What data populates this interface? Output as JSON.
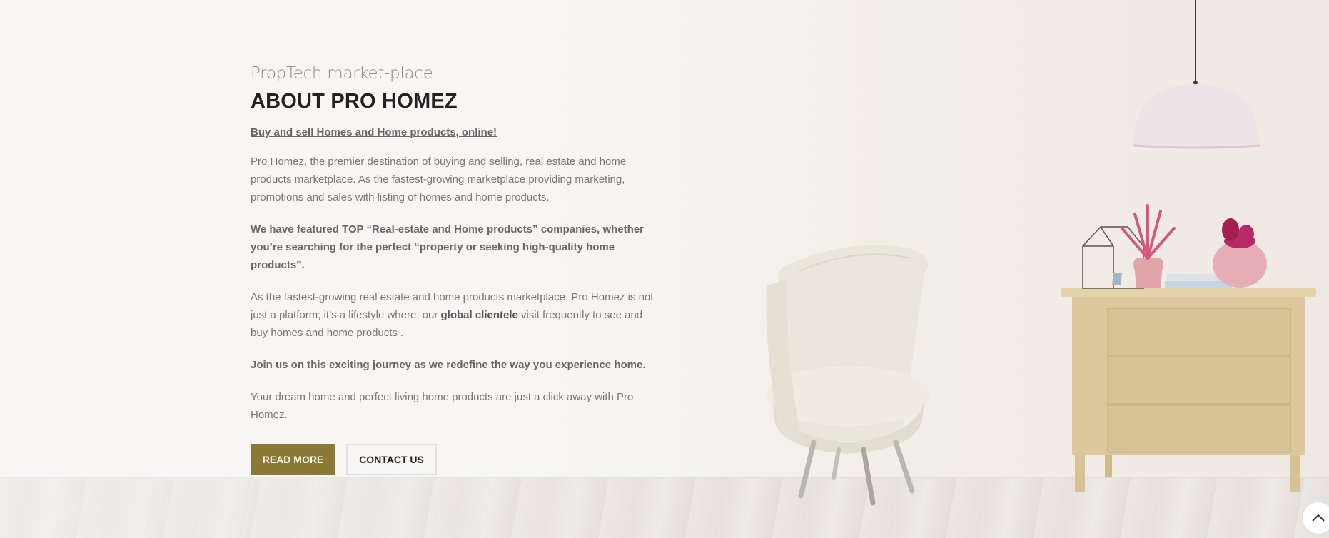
{
  "about": {
    "subtitle": "PropTech market-place",
    "title": "ABOUT PRO HOMEZ",
    "tagline": "Buy and sell Homes and Home products, online!",
    "para1": "Pro Homez, the premier destination of buying and selling, real estate and home products marketplace. As the fastest-growing marketplace providing marketing, promotions and sales with listing of homes and home products.",
    "para2": "We have featured TOP “Real-estate and Home products” companies, whether you’re searching for the perfect “property or seeking high-quality home products”.",
    "para3_start": "As the fastest-growing real estate and home products marketplace, Pro Homez is not just a platform; it’s a lifestyle where, our ",
    "para3_bold": "global clientele",
    "para3_end": " visit frequently to see and buy homes and home products .",
    "para4": "Join us on this exciting journey as we redefine the way you experience home.",
    "para5": "Your dream home and perfect living home products are just a click away with Pro Homez."
  },
  "buttons": {
    "read_more": "READ MORE",
    "contact_us": "CONTACT US"
  },
  "colors": {
    "primary_button": "#8b7a35",
    "heading": "#222222",
    "body_text": "#777777"
  },
  "icons": {
    "scroll_top": "chevron-up-icon"
  }
}
